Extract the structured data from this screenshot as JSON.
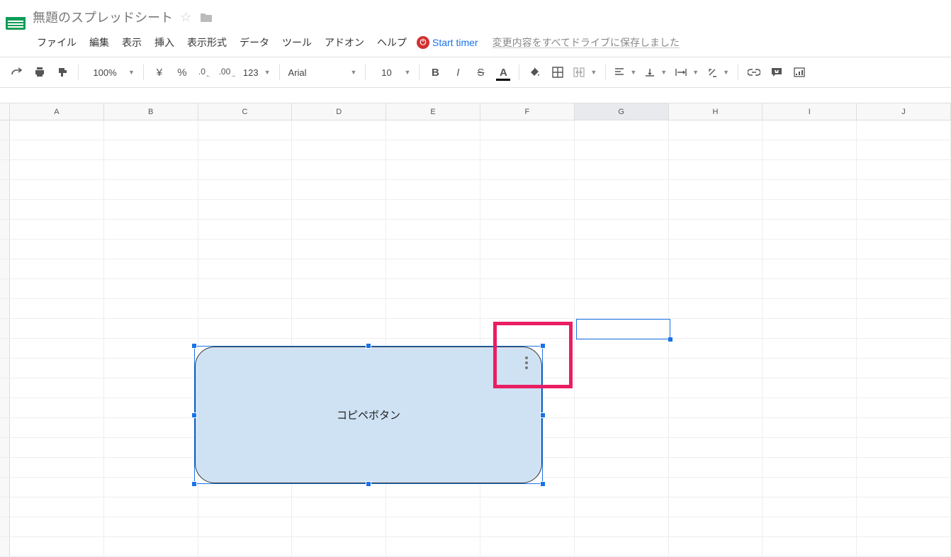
{
  "doc": {
    "title": "無題のスプレッドシート"
  },
  "menu": {
    "file": "ファイル",
    "edit": "編集",
    "view": "表示",
    "insert": "挿入",
    "format": "表示形式",
    "data": "データ",
    "tools": "ツール",
    "addons": "アドオン",
    "help": "ヘルプ",
    "timer": "Start timer",
    "save_status": "変更内容をすべてドライブに保存しました"
  },
  "toolbar": {
    "zoom": "100%",
    "currency": "¥",
    "percent": "%",
    "dec_less": ".0",
    "dec_more": ".00",
    "num_format": "123",
    "font": "Arial",
    "size": "10",
    "bold": "B",
    "italic": "I",
    "strike": "S",
    "textcolor": "A"
  },
  "columns": [
    "A",
    "B",
    "C",
    "D",
    "E",
    "F",
    "G",
    "H",
    "I",
    "J"
  ],
  "active_col_index": 6,
  "shape": {
    "label": "コピペボタン"
  }
}
